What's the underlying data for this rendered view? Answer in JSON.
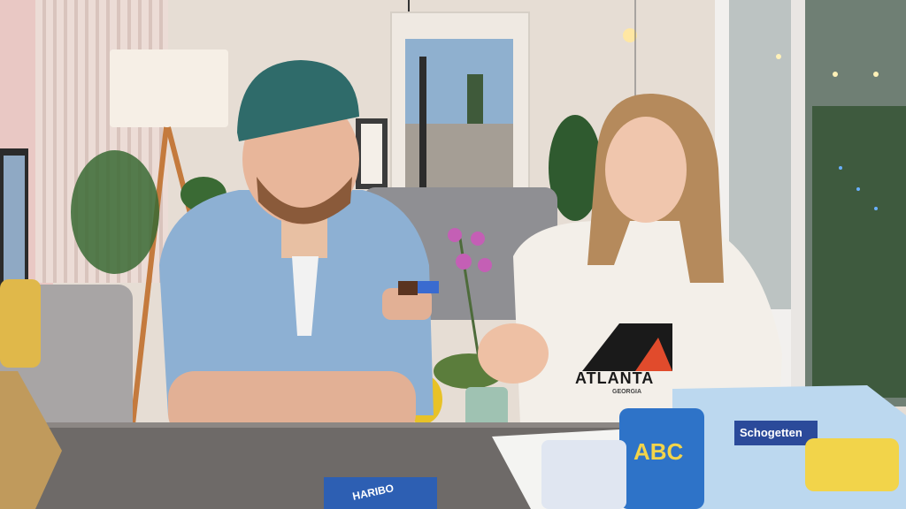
{
  "scene": {
    "shirt_text": "ATLANTA",
    "shirt_subtext": "GEORGIA",
    "snack_brand": "Schogetten",
    "snack_bag_text": "ABC",
    "snack_box_text": "HARIBO"
  }
}
